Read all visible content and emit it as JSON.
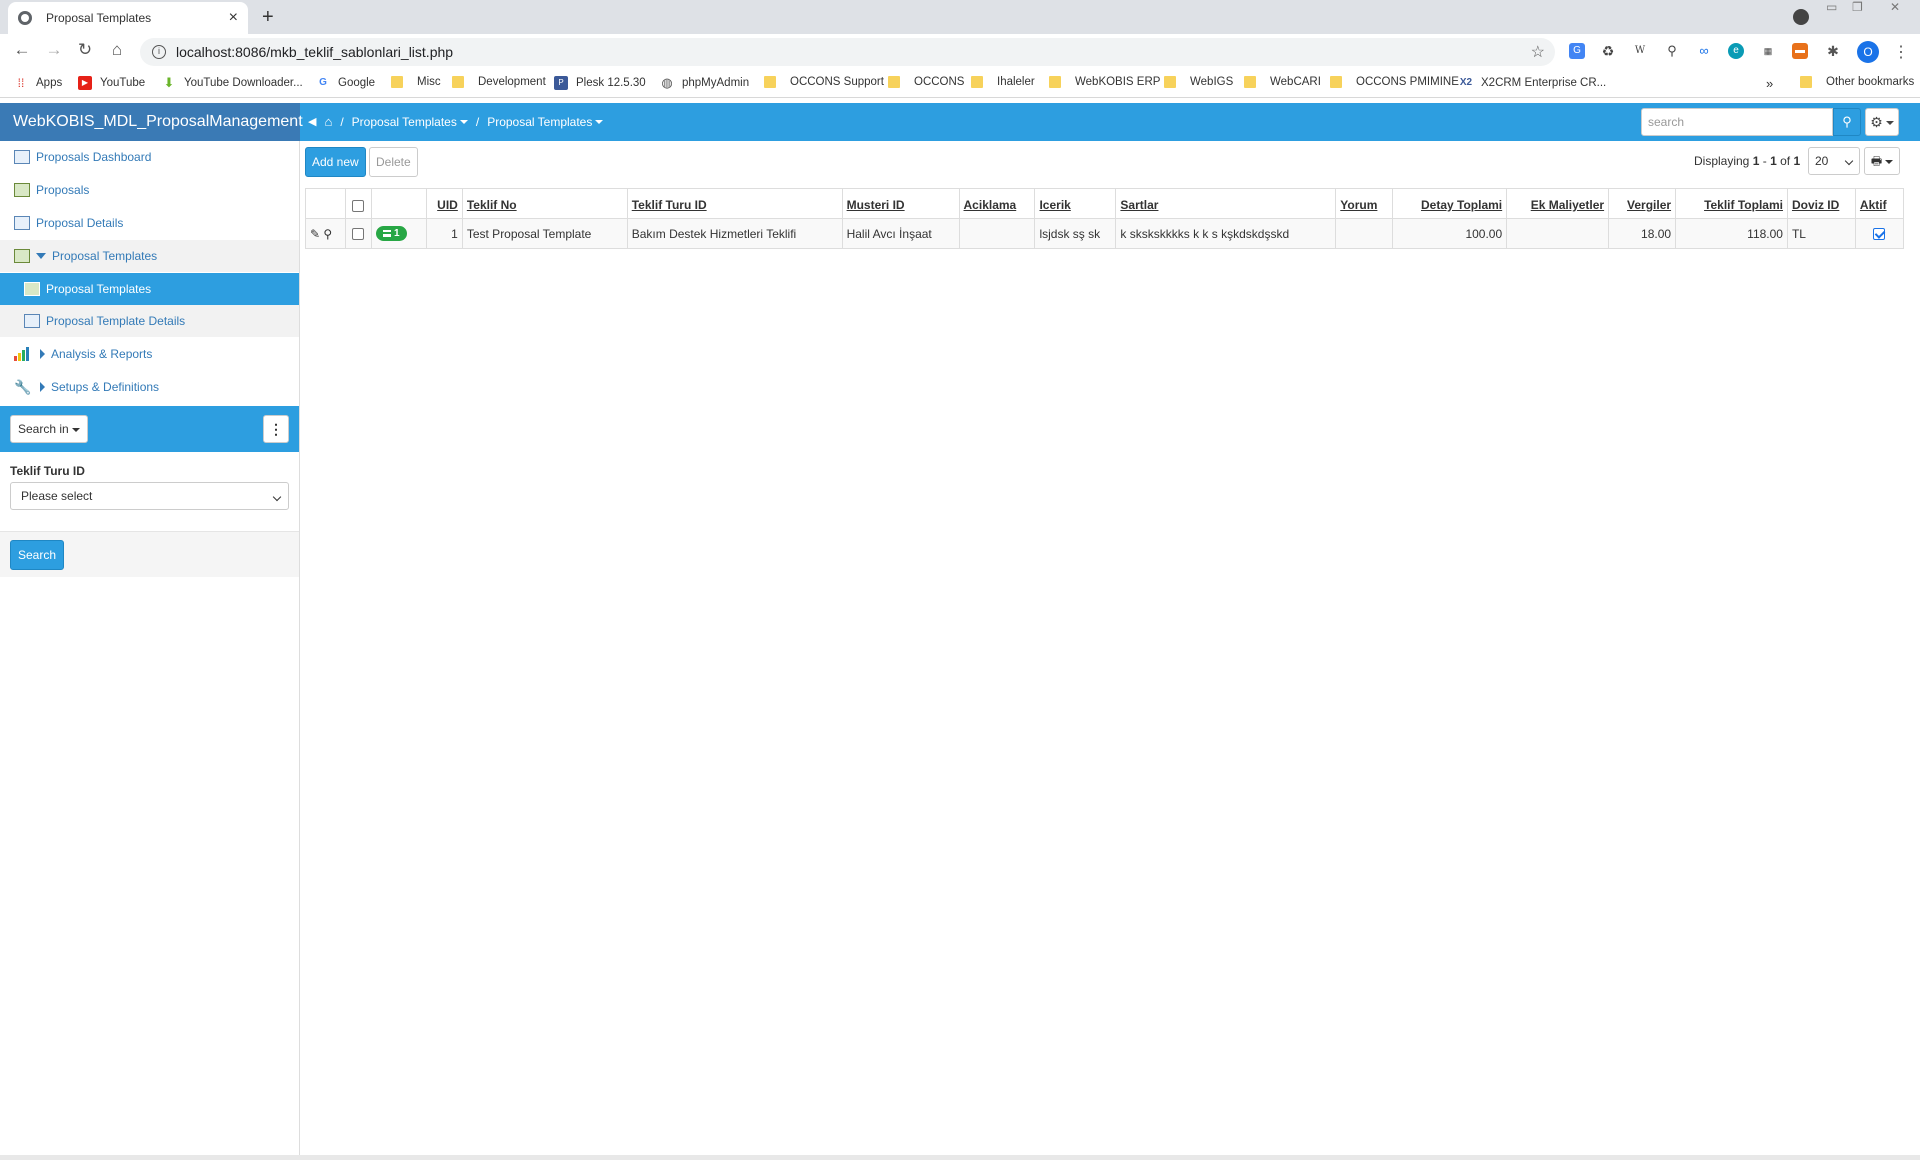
{
  "browser": {
    "tab_title": "Proposal Templates",
    "url": "localhost:8086/mkb_teklif_sablonlari_list.php",
    "avatar_letter": "O",
    "bookmarks": [
      {
        "label": "Apps",
        "kind": "apps"
      },
      {
        "label": "YouTube",
        "kind": "youtube"
      },
      {
        "label": "YouTube Downloader...",
        "kind": "download"
      },
      {
        "label": "Google",
        "kind": "google"
      },
      {
        "label": "Misc",
        "kind": "folder"
      },
      {
        "label": "Development",
        "kind": "folder"
      },
      {
        "label": "Plesk 12.5.30",
        "kind": "site"
      },
      {
        "label": "phpMyAdmin",
        "kind": "globe"
      },
      {
        "label": "OCCONS Support",
        "kind": "folder"
      },
      {
        "label": "OCCONS",
        "kind": "folder"
      },
      {
        "label": "Ihaleler",
        "kind": "folder"
      },
      {
        "label": "WebKOBIS ERP",
        "kind": "folder"
      },
      {
        "label": "WebIGS",
        "kind": "folder"
      },
      {
        "label": "WebCARI",
        "kind": "folder"
      },
      {
        "label": "OCCONS PMIMINE",
        "kind": "folder"
      },
      {
        "label": "X2CRM Enterprise CR...",
        "kind": "site"
      }
    ],
    "more_bookmarks": "»",
    "other_bookmarks": "Other bookmarks"
  },
  "app": {
    "brand": "WebKOBIS_MDL_ProposalManagement",
    "breadcrumb": [
      "Proposal Templates",
      "Proposal Templates"
    ],
    "search_placeholder": "search"
  },
  "sidebar": {
    "items": [
      {
        "label": "Proposals Dashboard"
      },
      {
        "label": "Proposals"
      },
      {
        "label": "Proposal Details"
      },
      {
        "label": "Proposal Templates"
      },
      {
        "label": "Proposal Templates"
      },
      {
        "label": "Proposal Template Details"
      },
      {
        "label": "Analysis & Reports"
      },
      {
        "label": "Setups & Definitions"
      }
    ],
    "search_in_label": "Search in",
    "filter_label": "Teklif Turu ID",
    "filter_value": "Please select",
    "search_button": "Search"
  },
  "list": {
    "add_new": "Add new",
    "delete": "Delete",
    "displaying_prefix": "Displaying",
    "range_start": "1",
    "range_sep": "-",
    "range_end": "1",
    "of": "of",
    "total": "1",
    "per_page": "20",
    "columns": [
      "UID",
      "Teklif No",
      "Teklif Turu ID",
      "Musteri ID",
      "Aciklama",
      "Icerik",
      "Sartlar",
      "Yorum",
      "Detay Toplami",
      "Ek Maliyetler",
      "Vergiler",
      "Teklif Toplami",
      "Doviz ID",
      "Aktif"
    ],
    "rows": [
      {
        "badge": "1",
        "uid": "1",
        "teklif_no": "Test Proposal Template",
        "teklif_turu": "Bakım Destek Hizmetleri Teklifi",
        "musteri": "Halil Avcı İnşaat",
        "aciklama": "",
        "icerik": "lsjdsk sş sk",
        "sartlar": "k skskskkkks k k s kşkdskdşskd",
        "yorum": "",
        "detay_toplami": "100.00",
        "ek_maliyetler": "",
        "vergiler": "18.00",
        "teklif_toplami": "118.00",
        "doviz": "TL",
        "aktif": true
      }
    ]
  },
  "colors": {
    "primary": "#2d9ee0",
    "brand_bg": "#3a7ab5",
    "link": "#337ab7",
    "badge": "#28a745"
  }
}
